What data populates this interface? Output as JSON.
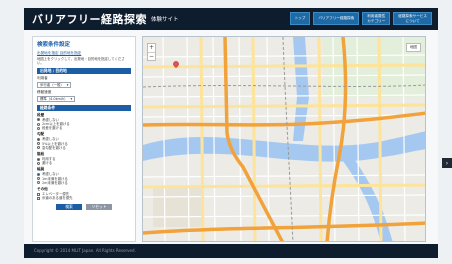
{
  "header": {
    "title": "バリアフリー経路探索",
    "subtitle": "体験サイト",
    "nav": [
      {
        "label": "トップ"
      },
      {
        "label": "バリアフリー経路探索"
      },
      {
        "label": "利用者属性\nカテゴリー"
      },
      {
        "label": "経路探索サービス\nについて"
      }
    ]
  },
  "sidebar": {
    "title": "検索条件設定",
    "link": "出発地を指定 目的地を指定",
    "note": "地図上をクリックして、出発地・目的地を指定してください。",
    "section_route": {
      "bar": "出発地 / 目的地",
      "label_mode": "利用者",
      "select_mode": "歩行者（一般）",
      "label_speed": "移動速度",
      "select_speed": "標準（4.0km/h）"
    },
    "section_conditions": {
      "bar": "経路条件",
      "groups": [
        {
          "head": "段差",
          "options": [
            {
              "label": "考慮しない",
              "on": true
            },
            {
              "label": "2cm以上を避ける",
              "on": false
            },
            {
              "label": "段差を避ける",
              "on": false
            }
          ]
        },
        {
          "head": "勾配",
          "options": [
            {
              "label": "考慮しない",
              "on": true
            },
            {
              "label": "5%以上を避ける",
              "on": false
            },
            {
              "label": "急勾配を避ける",
              "on": false
            }
          ]
        },
        {
          "head": "階段",
          "options": [
            {
              "label": "利用する",
              "on": true
            },
            {
              "label": "避ける",
              "on": false
            }
          ]
        },
        {
          "head": "幅員",
          "options": [
            {
              "label": "考慮しない",
              "on": true
            },
            {
              "label": "1m未満を避ける",
              "on": false
            },
            {
              "label": "2m未満を避ける",
              "on": false
            }
          ]
        },
        {
          "head": "その他",
          "options": [
            {
              "label": "エレベーター優先",
              "on": false
            },
            {
              "label": "歩道のある道を優先",
              "on": false
            }
          ]
        }
      ]
    },
    "btn_search": "検索",
    "btn_reset": "リセット"
  },
  "map": {
    "zoom_in": "+",
    "zoom_out": "−",
    "type_label": "地図"
  },
  "edge_tab": "›",
  "footer": {
    "text": "Copyright © 2014 MLIT Japan. All Rights Reserved."
  },
  "colors": {
    "header_bg": "#0e1d2e",
    "accent": "#1b5ea6",
    "river": "#a5c8f0",
    "highway": "#f2a23a",
    "road": "#fde49a"
  }
}
